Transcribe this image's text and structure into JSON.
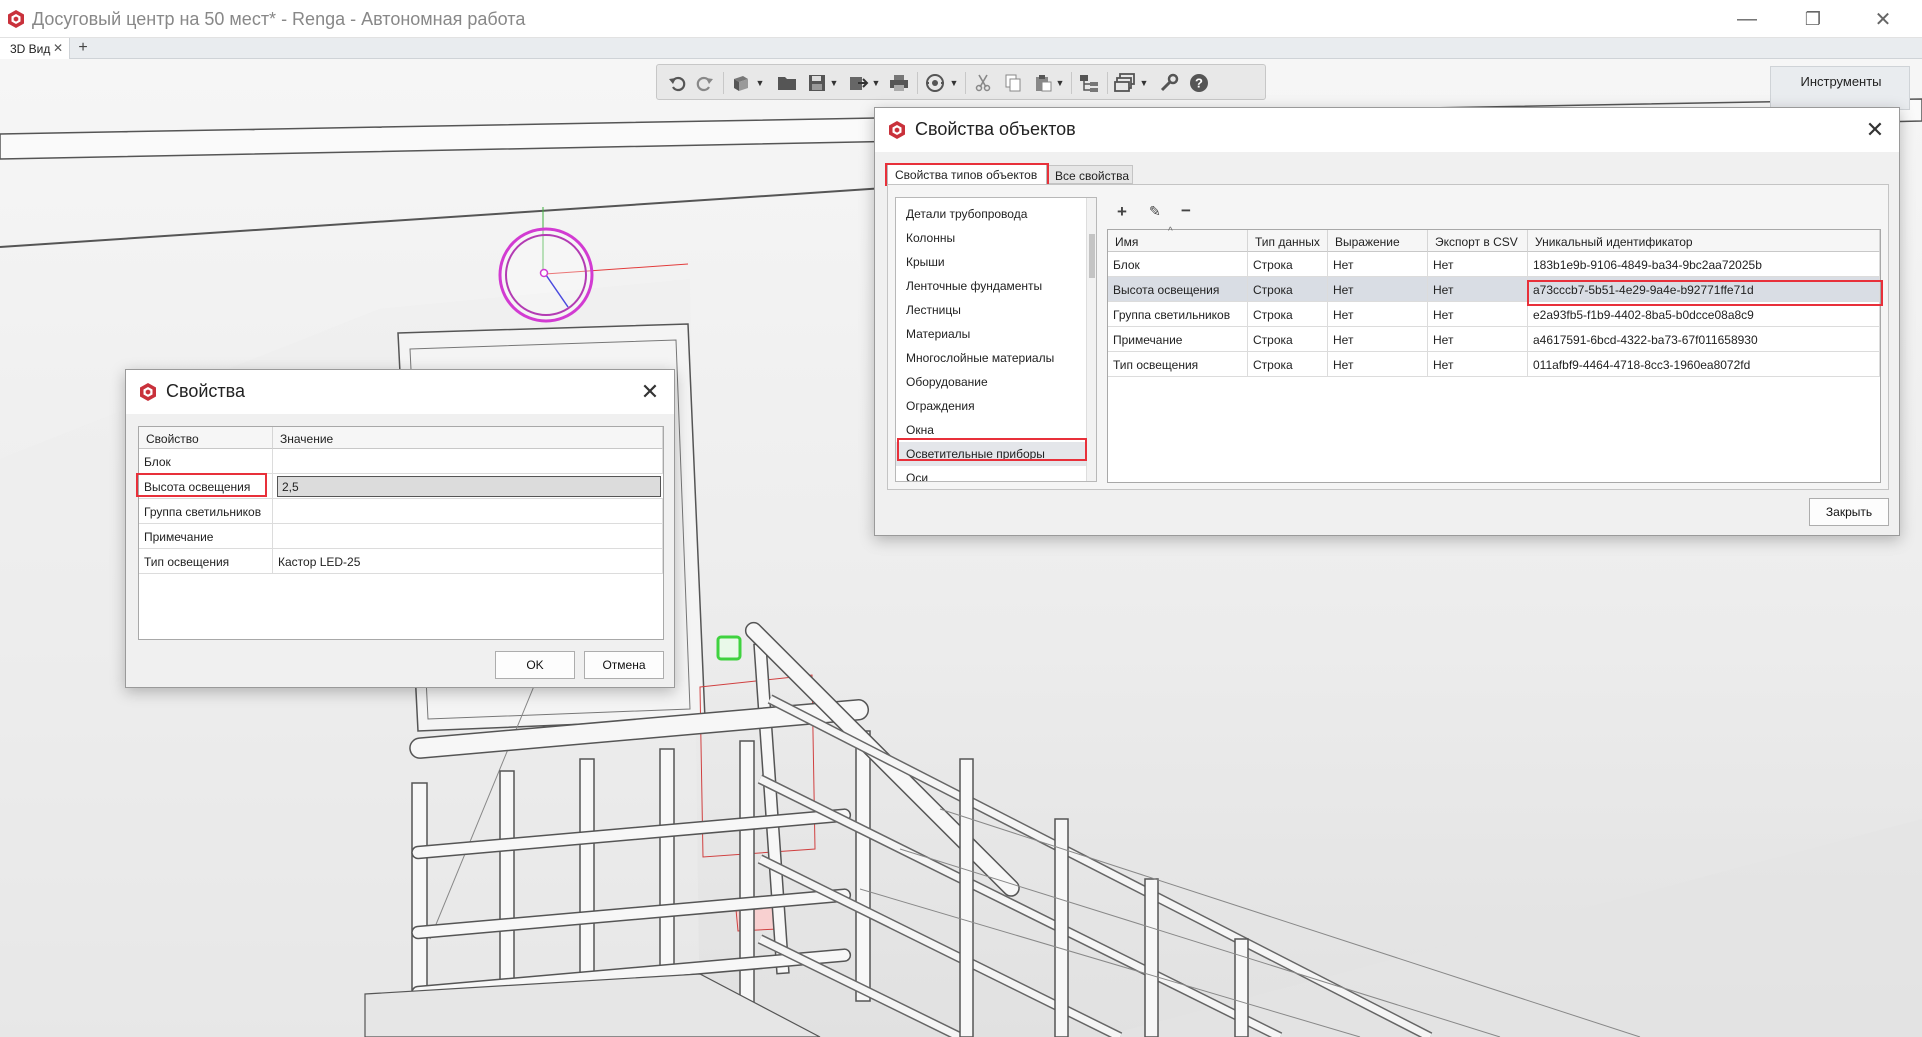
{
  "window": {
    "title": "Досуговый центр на 50 мест* - Renga - Автономная работа",
    "minimize": "—",
    "restore": "❐",
    "close": "✕"
  },
  "tabs": [
    {
      "label": "3D Вид",
      "close": "✕"
    }
  ],
  "tab_add": "+",
  "toolbar": {
    "icons": [
      "undo-icon",
      "redo-icon",
      "view-cube-icon",
      "open-folder-icon",
      "save-icon",
      "export-icon",
      "print-icon",
      "orbit-icon",
      "cut-icon",
      "copy-icon",
      "paste-icon",
      "object-structure-icon",
      "layers-icon",
      "wrench-icon",
      "help-icon"
    ],
    "help_glyph": "?"
  },
  "instruments": {
    "title": "Инструменты"
  },
  "props_dialog": {
    "title": "Свойства",
    "close": "✕",
    "col_property": "Свойство",
    "col_value": "Значение",
    "rows": [
      {
        "name": "Блок",
        "value": ""
      },
      {
        "name": "Высота освещения",
        "value": "2,5"
      },
      {
        "name": "Группа светильников",
        "value": ""
      },
      {
        "name": "Примечание",
        "value": ""
      },
      {
        "name": "Тип освещения",
        "value": "Кастор LED-25"
      }
    ],
    "ok": "OK",
    "cancel": "Отмена"
  },
  "obj_dialog": {
    "title": "Свойства объектов",
    "close": "✕",
    "tabs": [
      "Свойства типов объектов",
      "Все свойства"
    ],
    "categories": [
      "Детали трубопровода",
      "Колонны",
      "Крыши",
      "Ленточные фундаменты",
      "Лестницы",
      "Материалы",
      "Многослойные материалы",
      "Оборудование",
      "Ограждения",
      "Окна",
      "Осветительные приборы",
      "Оси"
    ],
    "selected_category": "Осветительные приборы",
    "actions": {
      "add": "+",
      "edit": "✎",
      "remove": "−"
    },
    "sort_glyph": "^",
    "columns": [
      "Имя",
      "Тип данных",
      "Выражение",
      "Экспорт в CSV",
      "Уникальный идентификатор"
    ],
    "rows": [
      {
        "name": "Блок",
        "type": "Строка",
        "expr": "Нет",
        "csv": "Нет",
        "uid": "183b1e9b-9106-4849-ba34-9bc2aa72025b"
      },
      {
        "name": "Высота освещения",
        "type": "Строка",
        "expr": "Нет",
        "csv": "Нет",
        "uid": "a73cccb7-5b51-4e29-9a4e-b92771ffe71d"
      },
      {
        "name": "Группа светильников",
        "type": "Строка",
        "expr": "Нет",
        "csv": "Нет",
        "uid": "e2a93fb5-f1b9-4402-8ba5-b0dcce08a8c9"
      },
      {
        "name": "Примечание",
        "type": "Строка",
        "expr": "Нет",
        "csv": "Нет",
        "uid": "a4617591-6bcd-4322-ba73-67f011658930"
      },
      {
        "name": "Тип освещения",
        "type": "Строка",
        "expr": "Нет",
        "csv": "Нет",
        "uid": "011afbf9-4464-4718-8cc3-1960ea8072fd"
      }
    ],
    "close_button": "Закрыть"
  },
  "colors": {
    "highlight": "#e8303a",
    "selected_row": "#d9dde4",
    "light_fixture": "#d23bd2",
    "selection_green": "#3fd23f"
  }
}
